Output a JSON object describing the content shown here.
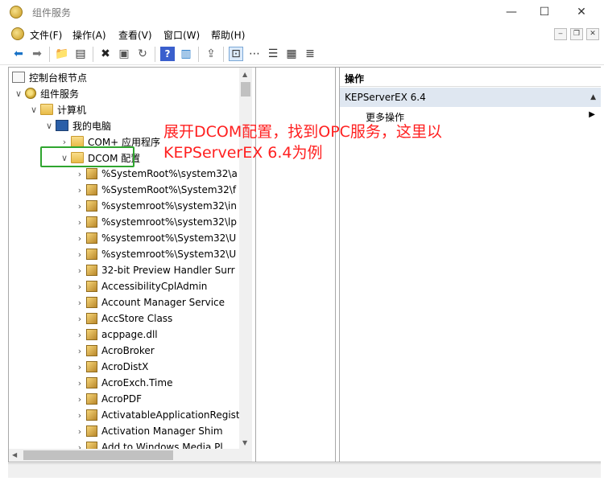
{
  "window": {
    "title": "组件服务",
    "controls": {
      "minimize": "—",
      "maximize": "☐",
      "close": "✕"
    }
  },
  "menu": [
    "文件(F)",
    "操作(A)",
    "查看(V)",
    "窗口(W)",
    "帮助(H)"
  ],
  "tree": {
    "root": "控制台根节点",
    "component_services": "组件服务",
    "computers": "计算机",
    "my_computer": "我的电脑",
    "com_plus": "COM+ 应用程序",
    "dcom": "DCOM 配置",
    "dcom_items": [
      "%SystemRoot%\\system32\\a",
      "%SystemRoot%\\System32\\f",
      "%systemroot%\\system32\\in",
      "%systemroot%\\system32\\lp",
      "%systemroot%\\System32\\U",
      "%systemroot%\\System32\\U",
      "32-bit Preview Handler Surr",
      "AccessibilityCplAdmin",
      "Account Manager Service",
      "AccStore Class",
      "acppage.dll",
      "AcroBroker",
      "AcroDistX",
      "AcroExch.Time",
      "AcroPDF",
      "ActivatableApplicationRegist",
      "Activation Manager Shim",
      "Add to Windows Media Pl"
    ]
  },
  "actions": {
    "header": "操作",
    "section": "KEPServerEX 6.4",
    "more": "更多操作"
  },
  "annotation": "展开DCOM配置，找到OPC服务，这里以KEPServerEX 6.4为例"
}
